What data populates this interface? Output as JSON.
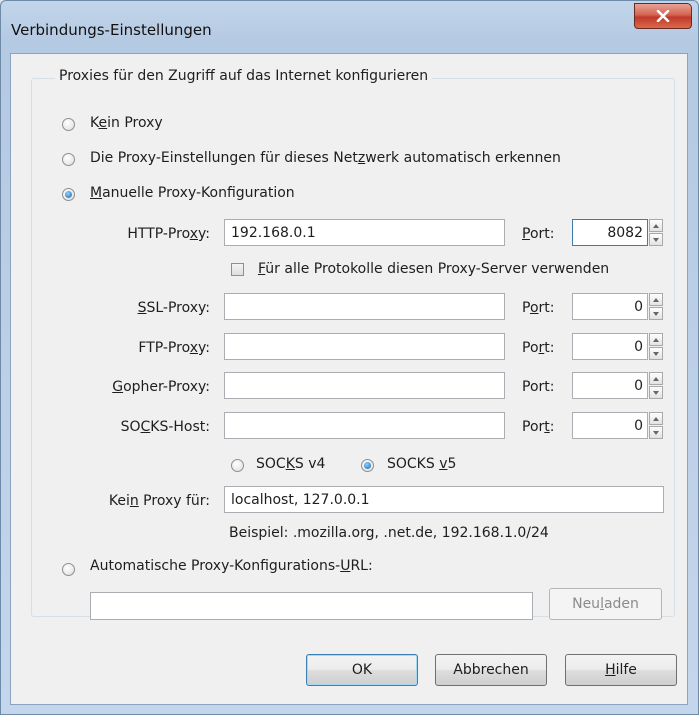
{
  "window": {
    "title": "Verbindungs-Einstellungen",
    "close_icon": "close-icon"
  },
  "group": {
    "legend": "Proxies für den Zugriff auf das Internet konfigurieren"
  },
  "options": {
    "no_proxy": "Kein Proxy",
    "auto_detect": "Die Proxy-Einstellungen für dieses Netzwerk automatisch erkennen",
    "manual": "Manuelle Proxy-Konfiguration",
    "auto_url": "Automatische Proxy-Konfigurations-URL:",
    "selected": "manual"
  },
  "manual": {
    "http": {
      "label": "HTTP-Proxy:",
      "value": "192.168.0.1",
      "port_label": "Port:",
      "port": "8082"
    },
    "same_for_all": {
      "label": "Für alle Protokolle diesen Proxy-Server verwenden",
      "checked": false
    },
    "ssl": {
      "label": "SSL-Proxy:",
      "value": "",
      "port_label": "Port:",
      "port": "0"
    },
    "ftp": {
      "label": "FTP-Proxy:",
      "value": "",
      "port_label": "Port:",
      "port": "0"
    },
    "gopher": {
      "label": "Gopher-Proxy:",
      "value": "",
      "port_label": "Port:",
      "port": "0"
    },
    "socks": {
      "label": "SOCKS-Host:",
      "value": "",
      "port_label": "Port:",
      "port": "0"
    },
    "socks_v4": "SOCKS v4",
    "socks_v5": "SOCKS v5",
    "socks_selected": "v5",
    "no_proxy_for": {
      "label": "Kein Proxy für:",
      "value": "localhost, 127.0.0.1"
    },
    "example": "Beispiel: .mozilla.org, .net.de, 192.168.1.0/24"
  },
  "auto_url": {
    "value": "",
    "reload_label": "Neu laden"
  },
  "buttons": {
    "ok": "OK",
    "cancel": "Abbrechen",
    "help": "Hilfe"
  }
}
